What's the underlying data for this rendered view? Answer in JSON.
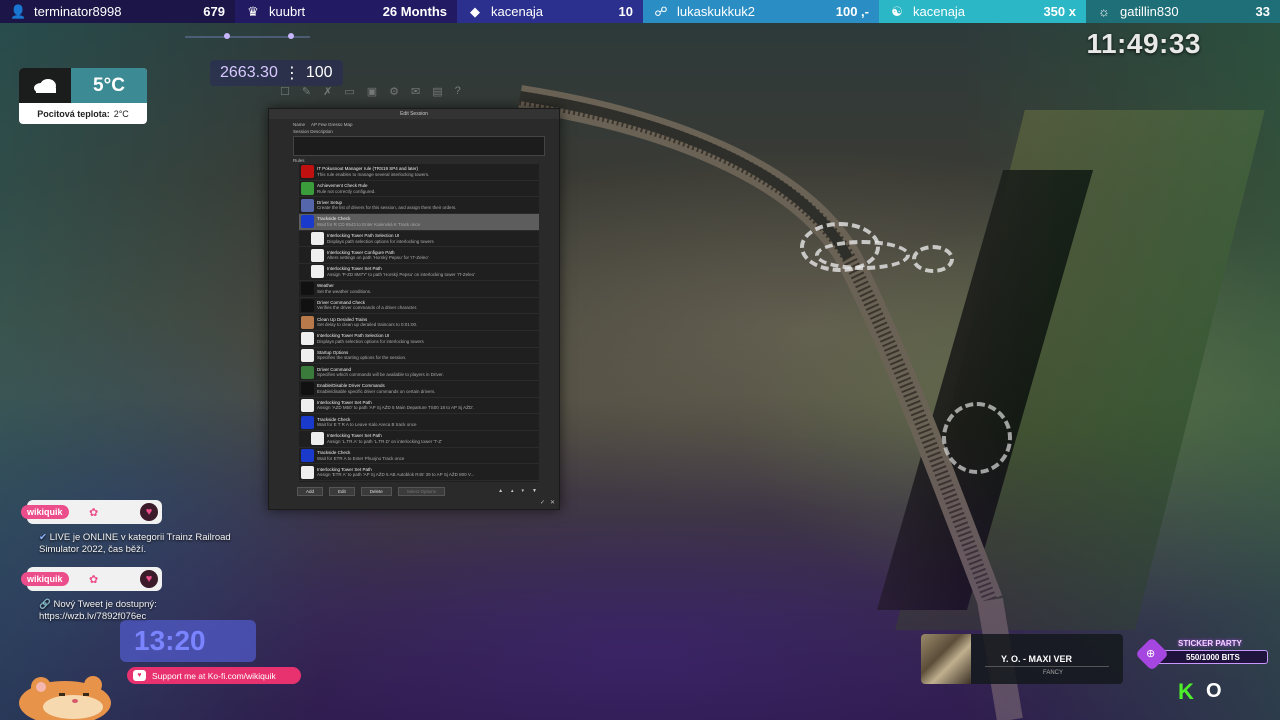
{
  "topbar": [
    {
      "name": "terminator8998",
      "value": "679",
      "icon": "user-add-icon"
    },
    {
      "name": "kuubrt",
      "value": "26 Months",
      "icon": "crown-icon"
    },
    {
      "name": "kacenaja",
      "value": "10",
      "icon": "diamond-icon"
    },
    {
      "name": "lukaskukkuk2",
      "value": "100 ,-",
      "icon": "donation-icon"
    },
    {
      "name": "kacenaja",
      "value": "350 x",
      "icon": "bits-icon"
    },
    {
      "name": "gatillin830",
      "value": "33",
      "icon": "community-icon"
    }
  ],
  "weather": {
    "temp": "5°C",
    "feel_label": "Pocitová teplota:",
    "feel_value": "2°C"
  },
  "counter": {
    "value": "2663.30",
    "separator": "⋮",
    "max": "100"
  },
  "clock": "11:49:33",
  "edit_window": {
    "title": "Edit Session",
    "tabs": [
      "Name",
      "AP Few Gresso Map"
    ],
    "desc_label": "Session Description",
    "rules_label": "Rules",
    "rules": [
      {
        "title": "IT Pokusnout Manager rule (TRS19 SP4 and later)",
        "desc": "This rule enables to manage several interlocking towers.",
        "color": "#c01010"
      },
      {
        "title": "Achievement Check Rule",
        "desc": "Rule not correctly configured.",
        "color": "#3a9c3a"
      },
      {
        "title": "Driver Setup",
        "desc": "Create the list of drivers for this session, and assign them their orders.",
        "color": "#5566aa"
      },
      {
        "title": "Trackside Check",
        "desc": "Wait for R CD 6543 to Enter Kalenská K Track once",
        "color": "#1a3acc",
        "selected": true
      },
      {
        "title": "Interlocking Tower Path Selection UI",
        "desc": "Displays path selection options for interlocking towers",
        "color": "#eeeeee",
        "nested": true
      },
      {
        "title": "Interlocking Tower Configure Path",
        "desc": "Alters settings on path 'Horský Pepsu' for 'IT-Zeleo'",
        "color": "#eeeeee",
        "nested": true
      },
      {
        "title": "Interlocking Tower Set Path",
        "desc": "Assign 'P-ZD 8M7Y' to path 'Horský Pepsu' on interlocking tower 'IT-Zeleo'",
        "color": "#eeeeee",
        "nested": true
      },
      {
        "title": "Weather",
        "desc": "Set the weather conditions.",
        "color": "#111111"
      },
      {
        "title": "Driver Command Check",
        "desc": "Verifies the driver commands of a driver character.",
        "color": "#111111"
      },
      {
        "title": "Clean Up Derailed Trains",
        "desc": "Set delay to clean up derailed traincars to 0:01:00.",
        "color": "#b87a4a"
      },
      {
        "title": "Interlocking Tower Path Selection UI",
        "desc": "Displays path selection options for interlocking towers",
        "color": "#eeeeee"
      },
      {
        "title": "Startup Options",
        "desc": "Specifies the starting options for the session.",
        "color": "#eeeeee"
      },
      {
        "title": "Driver Command",
        "desc": "Specifies which commands will be available to players in Driver.",
        "color": "#3a7a3a"
      },
      {
        "title": "Enable/Disable Driver Commands",
        "desc": "Enable/disable specific driver commands on certain drivers.",
        "color": "#111111"
      },
      {
        "title": "Interlocking Tower Set Path",
        "desc": "Assign 'AZD M50' to path 'AP Sj AŽD 5 Main Departure TS00 18 to AP Sj AŽD'.",
        "color": "#eeeeee"
      },
      {
        "title": "Trackside Check",
        "desc": "Wait for E T R A to Leave Kalo Areca B track once",
        "color": "#1a3acc"
      },
      {
        "title": "Interlocking Tower Set Path",
        "desc": "Assign 'L.TR.A' to path 'L.TR.D' on interlocking tower 'T-Z'",
        "color": "#eeeeee",
        "nested": true
      },
      {
        "title": "Trackside Check",
        "desc": "Wait for ETR A to Enter Phuojno Track once",
        "color": "#1a3acc"
      },
      {
        "title": "Interlocking Tower Set Path",
        "desc": "Assign 'ETR A' to path 'AP Sj AŽD 5 AB Autoblok R45' 39 to AP Sj AŽD 800 V...",
        "color": "#eeeeee"
      }
    ],
    "buttons": {
      "add": "Add",
      "edit": "Edit",
      "delete": "Delete",
      "set_options": "Select Options"
    }
  },
  "chat": [
    {
      "user": "wikiquik",
      "message": "LIVE je ONLINE v kategorii Trainz Railroad Simulator 2022, čas běží."
    },
    {
      "user": "wikiquik",
      "message": "Nový Tweet je dostupný: https://wzb.lv/7892f076ec"
    }
  ],
  "timer": {
    "value": "13:20"
  },
  "kofi": "Support me at Ko-fi.com/wikiquik",
  "now_playing": {
    "song": "Y. O. - MAXI VER",
    "artist": "FANCY"
  },
  "sticker": {
    "title": "STICKER PARTY",
    "bits": "550/1000 BITS"
  }
}
